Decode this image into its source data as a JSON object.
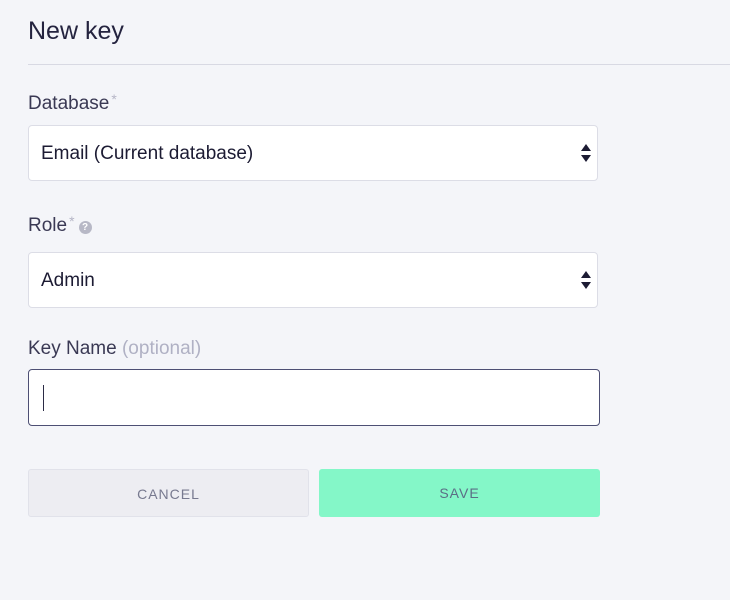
{
  "dialog": {
    "title": "New key"
  },
  "fields": {
    "database": {
      "label": "Database",
      "required_mark": "*",
      "selected": "Email (Current database)"
    },
    "role": {
      "label": "Role",
      "required_mark": "*",
      "help_icon": "question-circle-icon",
      "help_glyph": "?",
      "selected": "Admin"
    },
    "key_name": {
      "label": "Key Name",
      "optional_text": "(optional)",
      "value": ""
    }
  },
  "actions": {
    "cancel_label": "CANCEL",
    "save_label": "SAVE"
  },
  "colors": {
    "background": "#f4f5f9",
    "save_button": "#84f7c8",
    "cancel_button": "#ededf2",
    "focused_border": "#4d4f74"
  }
}
